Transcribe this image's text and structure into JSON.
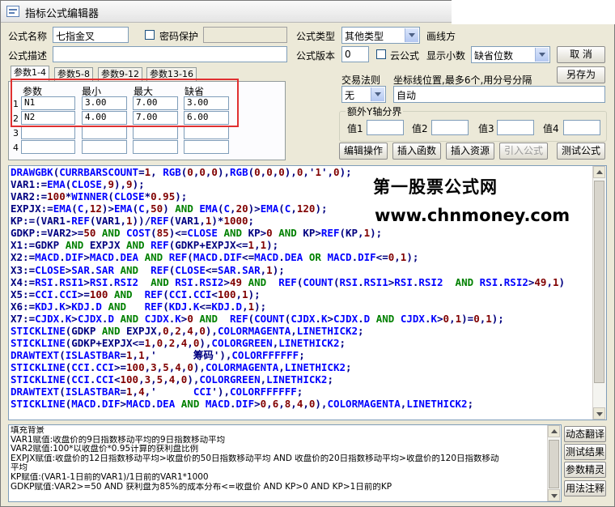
{
  "window": {
    "title": "指标公式编辑器"
  },
  "form": {
    "name_label": "公式名称",
    "name_value": "七指金叉",
    "password_label": "密码保护",
    "type_label": "公式类型",
    "type_value": "其他类型",
    "chart_label": "画线方",
    "desc_label": "公式描述",
    "version_label": "公式版本",
    "version_value": "0",
    "cloud_label": "云公式",
    "decimals_label": "显示小数",
    "decimals_value": "缺省位数",
    "cancel_label": "取 消",
    "saveas_label": "另存为",
    "trade_label": "交易法则",
    "trade_value": "无",
    "coord_label": "坐标线位置,最多6个,用分号分隔",
    "coord_value": "自动",
    "yaxis_group_label": "额外Y轴分界",
    "value_labels": [
      "值1",
      "值2",
      "值3",
      "值4"
    ]
  },
  "tabs": [
    "参数1-4",
    "参数5-8",
    "参数9-12",
    "参数13-16"
  ],
  "params": {
    "headers": [
      "参数",
      "最小",
      "最大",
      "缺省"
    ],
    "rows": [
      {
        "num": "1",
        "name": "N1",
        "min": "3.00",
        "max": "7.00",
        "def": "3.00"
      },
      {
        "num": "2",
        "name": "N2",
        "min": "4.00",
        "max": "7.00",
        "def": "6.00"
      },
      {
        "num": "3",
        "name": "",
        "min": "",
        "max": "",
        "def": ""
      },
      {
        "num": "4",
        "name": "",
        "min": "",
        "max": "",
        "def": ""
      }
    ]
  },
  "actions": [
    "编辑操作",
    "插入函数",
    "插入资源",
    "引入公式",
    "测试公式"
  ],
  "watermark": {
    "line1": "第一股票公式网",
    "line2": "www.chnmoney.com"
  },
  "code_lines": [
    "DRAWGBK(CURRBARSCOUNT=1, RGB(0,0,0),RGB(0,0,0),0,'1',0);",
    "VAR1:=EMA(CLOSE,9),9);",
    "VAR2:=100*WINNER(CLOSE*0.95);",
    "EXPJX:=EMA(C,12)>EMA(C,50) AND EMA(C,20)>EMA(C,120);",
    "KP:=(VAR1-REF(VAR1,1))/REF(VAR1,1)*1000;",
    "GDKP:=VAR2>=50 AND COST(85)<=CLOSE AND KP>0 AND KP>REF(KP,1);",
    "X1:=GDKP AND EXPJX AND REF(GDKP+EXPJX<=1,1);",
    "X2:=MACD.DIF>MACD.DEA AND REF(MACD.DIF<=MACD.DEA OR MACD.DIF<=0,1);",
    "X3:=CLOSE>SAR.SAR AND  REF(CLOSE<=SAR.SAR,1);",
    "X4:=RSI.RSI1>RSI.RSI2  AND RSI.RSI2>49 AND  REF(COUNT(RSI.RSI1>RSI.RSI2  AND RSI.RSI2>49,1)",
    "X5:=CCI.CCI>=100 AND  REF(CCI.CCI<100,1);",
    "X6:=KDJ.K>KDJ.D AND   REF(KDJ.K<=KDJ.D,1);",
    "X7:=CJDX.K>CJDX.D AND CJDX.K>0 AND  REF(COUNT(CJDX.K>CJDX.D AND CJDX.K>0,1)=0,1);",
    "STICKLINE(GDKP AND EXPJX,0,2,4,0),COLORMAGENTA,LINETHICK2;",
    "STICKLINE(GDKP+EXPJX<=1,0,2,4,0),COLORGREEN,LINETHICK2;",
    "DRAWTEXT(ISLASTBAR=1,1,'      筹码'),COLORFFFFFF;",
    "STICKLINE(CCI.CCI>=100,3,5,4,0),COLORMAGENTA,LINETHICK2;",
    "STICKLINE(CCI.CCI<100,3,5,4,0),COLORGREEN,LINETHICK2;",
    "DRAWTEXT(ISLASTBAR=1,4,'      CCI'),COLORFFFFFF;",
    "STICKLINE(MACD.DIF>MACD.DEA AND MACD.DIF>0,6,8,4,0),COLORMAGENTA,LINETHICK2;"
  ],
  "notes": [
    "填充背景",
    "VAR1赋值:收盘价的9日指数移动平均的9日指数移动平均",
    "VAR2赋值:100*以收盘价*0.95计算的获利盘比例",
    "EXPJX赋值:收盘价的12日指数移动平均>收盘价的50日指数移动平均 AND 收盘价的20日指数移动平均>收盘价的120日指数移动",
    "平均",
    "KP赋值:(VAR1-1日前的VAR1)/1日前的VAR1*1000",
    "GDKP赋值:VAR2>=50 AND 获利盘为85%的成本分布<=收盘价 AND KP>0 AND KP>1日前的KP"
  ],
  "side_buttons": [
    "动态翻译",
    "测试结果",
    "参数精灵",
    "用法注释"
  ]
}
